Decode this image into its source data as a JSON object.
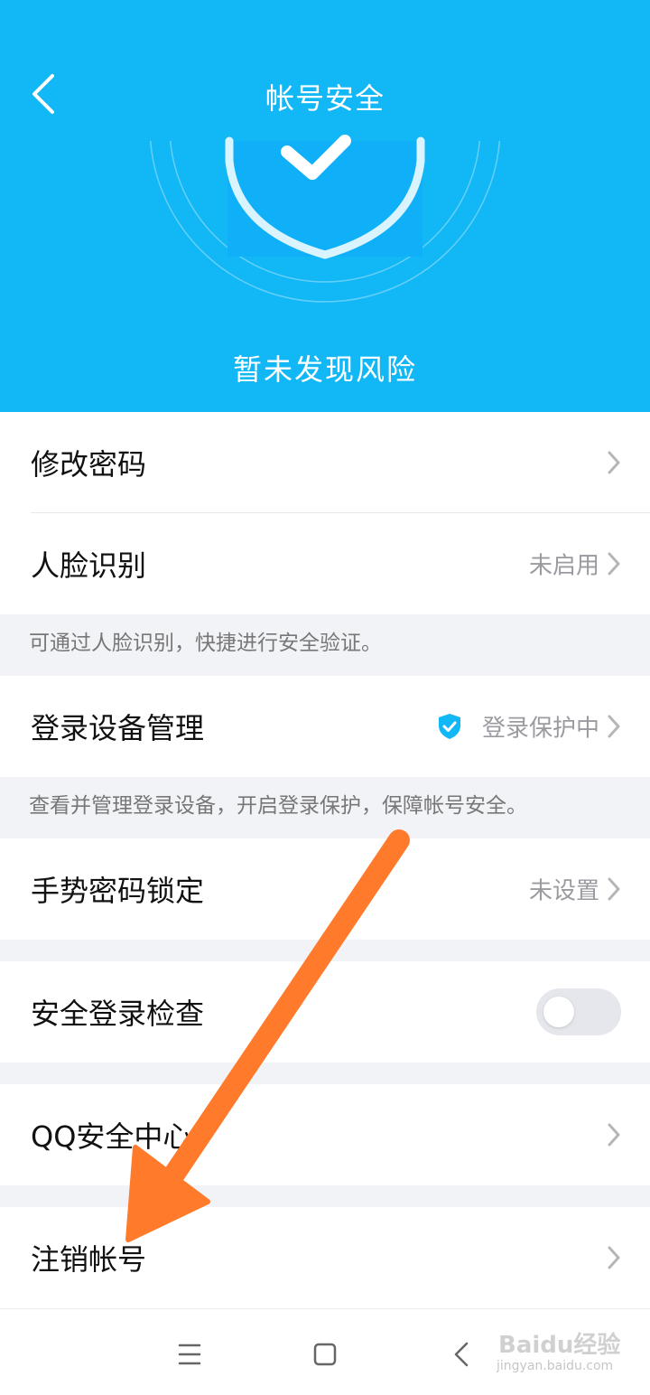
{
  "header": {
    "title": "帐号安全",
    "status_text": "暂未发现风险",
    "color": "#12b7f5"
  },
  "rows": [
    {
      "label": "修改密码",
      "value": ""
    },
    {
      "label": "人脸识别",
      "value": "未启用"
    },
    {
      "label": "登录设备管理",
      "value": "登录保护中"
    },
    {
      "label": "手势密码锁定",
      "value": "未设置"
    },
    {
      "label": "安全登录检查",
      "toggle": false
    },
    {
      "label": "QQ安全中心",
      "value": ""
    },
    {
      "label": "注销帐号",
      "value": ""
    }
  ],
  "hints": {
    "face": "可通过人脸识别，快捷进行安全验证。",
    "device": "查看并管理登录设备，开启登录保护，保障帐号安全。"
  },
  "icons": {
    "back": "back-chevron-icon",
    "menu": "menu-icon",
    "home": "home-icon",
    "nav_back": "nav-back-icon"
  },
  "watermark": {
    "logo": "Baidu经验",
    "url": "jingyan.baidu.com"
  },
  "annotation_color": "#ff7a2a"
}
